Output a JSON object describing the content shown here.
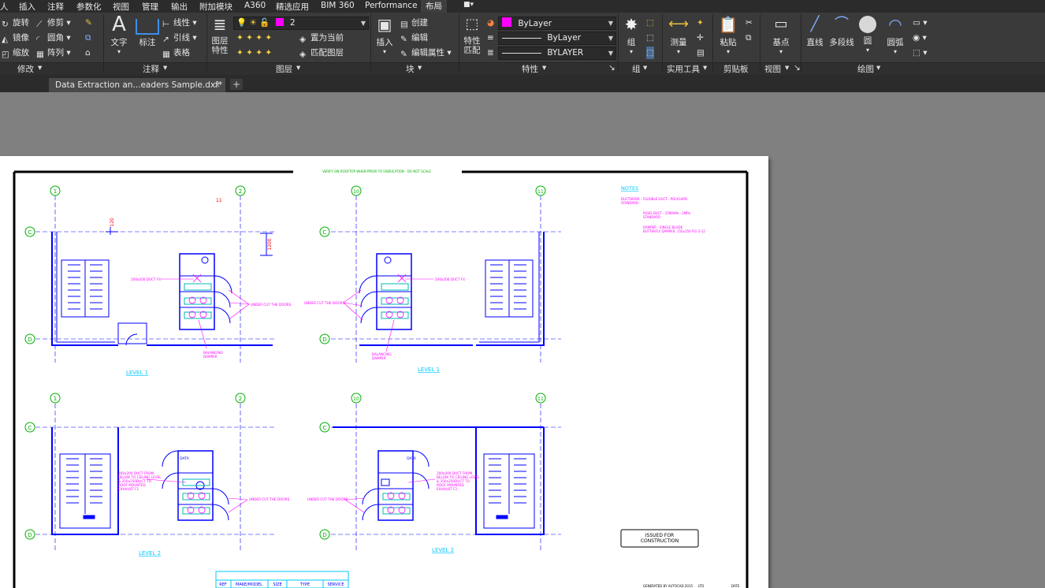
{
  "menu": [
    "人",
    "插入",
    "注释",
    "参数化",
    "视图",
    "管理",
    "输出",
    "附加模块",
    "A360",
    "精选应用",
    "BIM 360",
    "Performance",
    "布局"
  ],
  "ribbon": {
    "modify": {
      "items": [
        "旋转",
        "镜像",
        "缩放",
        "修剪",
        "圆角",
        "阵列"
      ],
      "label": "修改"
    },
    "annotation": {
      "text": "文字",
      "dim": "标注",
      "linear": "线性",
      "leader": "引线",
      "table": "表格",
      "label": "注释"
    },
    "layers": {
      "props": "图层\n特性",
      "current_layer": "2",
      "set_current": "置为当前",
      "match": "匹配图层",
      "label": "图层"
    },
    "block": {
      "insert": "插入",
      "create": "创建",
      "edit": "编辑",
      "edit_attr": "编辑属性",
      "label": "块"
    },
    "properties": {
      "match": "特性\n匹配",
      "color": "ByLayer",
      "linetype": "ByLayer",
      "lineweight": "BYLAYER",
      "label": "特性"
    },
    "groups": {
      "group": "组",
      "label": "组"
    },
    "utilities": {
      "measure": "测量",
      "label": "实用工具"
    },
    "clipboard": {
      "paste": "粘贴",
      "label": "剪贴板"
    },
    "view": {
      "base": "基点",
      "label": "视图"
    },
    "draw": {
      "line": "直线",
      "polyline": "多段线",
      "circle": "圆",
      "arc": "圆弧",
      "label": "绘图"
    }
  },
  "tab": {
    "title": "Data Extraction an...eaders Sample.dxf*",
    "close": "×",
    "new": "+"
  },
  "colors": {
    "drawing_blue": "#0000ff",
    "annotation_magenta": "#ff00ff",
    "grid_green": "#00b000",
    "notes_cyan": "#00c8ff"
  },
  "drawing": {
    "header_note": "VERIFY ON ROOFTOP WHEN PRIOR TO FABRICATION - DO NOT SCALE",
    "grid_bubbles_left": [
      "1",
      "2",
      "C",
      "D"
    ],
    "grid_bubbles_right": [
      "10",
      "11",
      "C",
      "D"
    ],
    "dim_120": "120",
    "dim_1200": "1200",
    "mark_11": "11",
    "level1_left": "LEVEL 1",
    "level1_right": "LEVEL 1",
    "level2_left": "LEVEL 2",
    "level2_right": "LEVEL 2",
    "duct_label": "200x200 DUCT F4",
    "undercut": "UNDER CUT THE DOORS",
    "balancing": "BALANCING\nDAMPER",
    "duct_riser_left": "200x200 DUCT FROM\nBELOW TO CEILING LEVEL\n& 250x250DUCT TO\nROOF MOUNTED\nEXHAUST F1",
    "duct_riser_right": "200x200 DUCT FROM\nBELOW TO CEILING LEVEL\n& 250x250DUCT TO\nROOF MOUNTED\nEXHAUST F2",
    "data_label": "DATA",
    "notes_title": "NOTES",
    "notes": [
      "DUCTWORK - FLEXIBLE DUCT - POLYGARD\nSTANDARD",
      "RIGID DUCT - 25MAMA - 2MPa\nSTANDARD",
      "DAMPER - SINGLE BLADE\nBUTTERFLY DAMPER, 150x150 FIG 2-12"
    ],
    "stamp": "ISSUED FOR\nCONSTRUCTION",
    "table_headers": [
      "REF",
      "MAKE/MODEL",
      "SIZE",
      "TYPE",
      "SERVICE"
    ],
    "footer_left": "GENERATED BY AUTOCAD 2015",
    "footer_mid": "LTD",
    "footer_right": "DATE"
  }
}
